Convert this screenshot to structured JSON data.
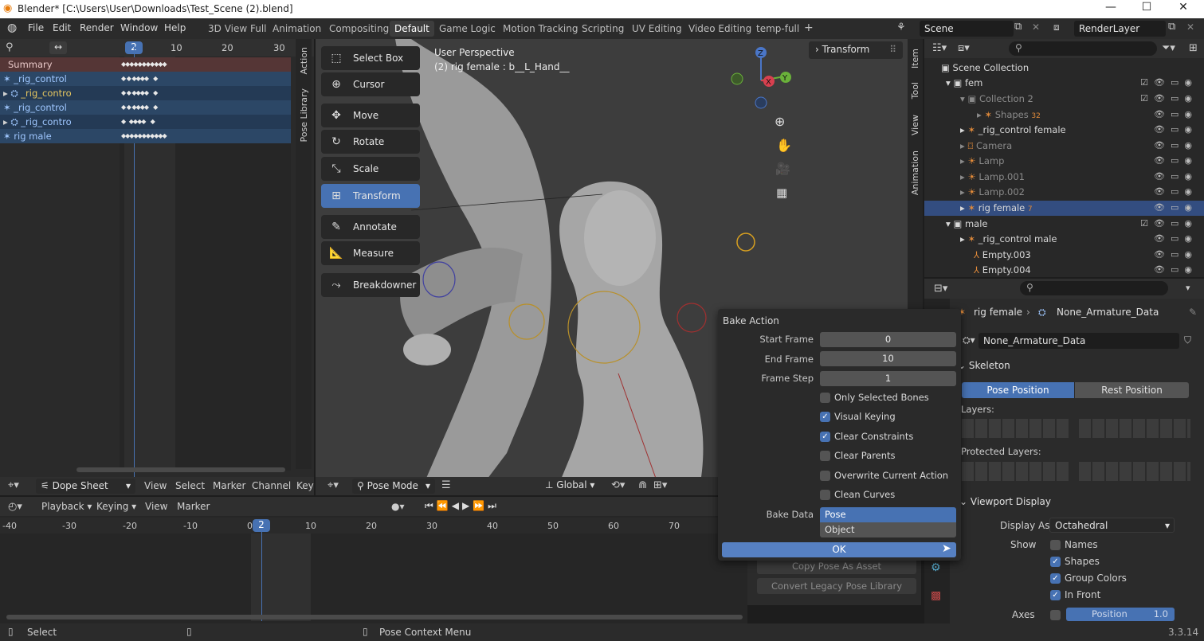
{
  "window": {
    "title": "Blender* [C:\\Users\\User\\Downloads\\Test_Scene (2).blend]",
    "minimize": "—",
    "maximize": "☐",
    "close": "✕"
  },
  "menus": [
    "File",
    "Edit",
    "Render",
    "Window",
    "Help"
  ],
  "workspaces": [
    "3D View Full",
    "Animation",
    "Compositing",
    "Default",
    "Game Logic",
    "Motion Tracking",
    "Scripting",
    "UV Editing",
    "Video Editing",
    "temp-full",
    "+"
  ],
  "scene": {
    "name": "Scene",
    "render_layer": "RenderLayer"
  },
  "dopesheet": {
    "frame_ticks": [
      "2",
      "10",
      "20",
      "30"
    ],
    "current_frame": "2",
    "channels": [
      "Summary",
      "_rig_control",
      "_rig_contro",
      "_rig_control",
      "_rig_contro",
      "rig male"
    ],
    "side_tabs": [
      "Action",
      "Pose Library"
    ],
    "header": {
      "mode": "Dope Sheet",
      "menu": [
        "View",
        "Select",
        "Marker",
        "Channel",
        "Key"
      ]
    }
  },
  "viewport": {
    "perspective": "User Perspective",
    "active": "(2) rig female : b__L_Hand__",
    "tools": [
      "Select Box",
      "Cursor",
      "Move",
      "Rotate",
      "Scale",
      "Transform",
      "Annotate",
      "Measure",
      "Breakdowner"
    ],
    "active_tool": "Transform",
    "n_panel": "Transform",
    "side_tabs": [
      "Item",
      "Tool",
      "View",
      "Animation"
    ],
    "header": {
      "mode": "Pose Mode",
      "orientation": "Global"
    },
    "gizmo": {
      "x": "X",
      "y": "Y",
      "z": "Z"
    }
  },
  "outliner": {
    "search_placeholder": "",
    "items": [
      {
        "label": "Scene Collection"
      },
      {
        "label": "fem"
      },
      {
        "label": "Collection 2"
      },
      {
        "label": "Shapes",
        "badge": "32"
      },
      {
        "label": "_rig_control female"
      },
      {
        "label": "Camera"
      },
      {
        "label": "Lamp"
      },
      {
        "label": "Lamp.001"
      },
      {
        "label": "Lamp.002"
      },
      {
        "label": "rig female",
        "badge": "7"
      },
      {
        "label": "male"
      },
      {
        "label": "_rig_control male"
      },
      {
        "label": "Empty.003"
      },
      {
        "label": "Empty.004"
      }
    ]
  },
  "properties": {
    "breadcrumb": [
      "rig female",
      "None_Armature_Data"
    ],
    "data_name": "None_Armature_Data",
    "skeleton": "Skeleton",
    "pose_position": "Pose Position",
    "rest_position": "Rest Position",
    "layers": "Layers:",
    "protected_layers": "Protected Layers:",
    "viewport_display": "Viewport Display",
    "display_as_label": "Display As",
    "display_as": "Octahedral",
    "show_label": "Show",
    "show": [
      {
        "label": "Names",
        "checked": false
      },
      {
        "label": "Shapes",
        "checked": true
      },
      {
        "label": "Group Colors",
        "checked": true
      },
      {
        "label": "In Front",
        "checked": true
      }
    ],
    "axes_label": "Axes",
    "axes_field": "Position",
    "axes_value": "1.0"
  },
  "pose_lib": {
    "copy": "Copy Pose As Asset",
    "convert": "Convert Legacy Pose Library"
  },
  "timeline": {
    "header": [
      "Playback",
      "Keying",
      "View",
      "Marker"
    ],
    "ticks": [
      "-40",
      "-30",
      "-20",
      "-10",
      "0",
      "10",
      "20",
      "30",
      "40",
      "50",
      "60",
      "70"
    ],
    "current_frame": "2"
  },
  "bake": {
    "title": "Bake Action",
    "start_label": "Start Frame",
    "start": "0",
    "end_label": "End Frame",
    "end": "10",
    "step_label": "Frame Step",
    "step": "1",
    "options": [
      {
        "label": "Only Selected Bones",
        "checked": false
      },
      {
        "label": "Visual Keying",
        "checked": true
      },
      {
        "label": "Clear Constraints",
        "checked": true
      },
      {
        "label": "Clear Parents",
        "checked": false
      },
      {
        "label": "Overwrite Current Action",
        "checked": false
      },
      {
        "label": "Clean Curves",
        "checked": false
      }
    ],
    "bake_data_label": "Bake Data",
    "bake_data": [
      "Pose",
      "Object"
    ],
    "ok": "OK"
  },
  "status": {
    "left": "Select",
    "middle": "Pose Context Menu",
    "version": "3.3.14"
  }
}
